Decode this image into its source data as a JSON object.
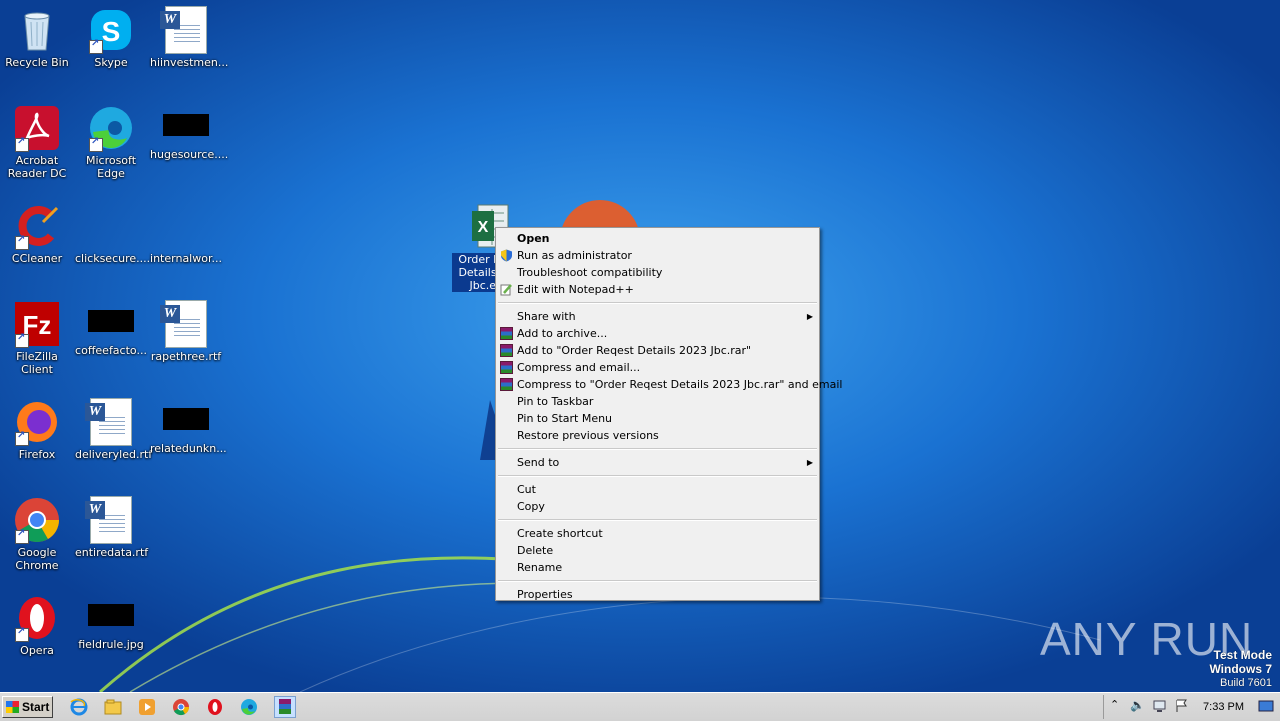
{
  "desktop": {
    "icons": [
      {
        "label": "Recycle Bin"
      },
      {
        "label": "Skype"
      },
      {
        "label": "hiinvestmen..."
      },
      {
        "label": "Acrobat Reader DC"
      },
      {
        "label": "Microsoft Edge"
      },
      {
        "label": "hugesource...."
      },
      {
        "label": "CCleaner"
      },
      {
        "label": "clicksecure...."
      },
      {
        "label": "internalwor..."
      },
      {
        "label": "FileZilla Client"
      },
      {
        "label": "coffeefacto..."
      },
      {
        "label": "rapethree.rtf"
      },
      {
        "label": "Firefox"
      },
      {
        "label": "deliveryled.rtf"
      },
      {
        "label": "relatedunkn..."
      },
      {
        "label": "Google Chrome"
      },
      {
        "label": "entiredata.rtf"
      },
      {
        "label": "Opera"
      },
      {
        "label": "fieldrule.jpg"
      }
    ],
    "selected_file": {
      "label": "Order Re... Details 2... Jbc.e..."
    }
  },
  "context_menu": {
    "items": [
      {
        "label": "Open"
      },
      {
        "label": "Run as administrator"
      },
      {
        "label": "Troubleshoot compatibility"
      },
      {
        "label": "Edit with Notepad++"
      },
      {
        "label": "Share with"
      },
      {
        "label": "Add to archive..."
      },
      {
        "label": "Add to \"Order Reqest Details 2023 Jbc.rar\""
      },
      {
        "label": "Compress and email..."
      },
      {
        "label": "Compress to \"Order Reqest Details 2023 Jbc.rar\" and email"
      },
      {
        "label": "Pin to Taskbar"
      },
      {
        "label": "Pin to Start Menu"
      },
      {
        "label": "Restore previous versions"
      },
      {
        "label": "Send to"
      },
      {
        "label": "Cut"
      },
      {
        "label": "Copy"
      },
      {
        "label": "Create shortcut"
      },
      {
        "label": "Delete"
      },
      {
        "label": "Rename"
      },
      {
        "label": "Properties"
      }
    ]
  },
  "taskbar": {
    "start_label": "Start",
    "clock": "7:33 PM",
    "pinned": [
      "internet-explorer-icon",
      "explorer-icon",
      "media-player-icon",
      "chrome-icon",
      "opera-icon",
      "edge-icon",
      "winrar-icon"
    ]
  },
  "watermark": {
    "line1": "Test Mode",
    "line2": "Windows 7",
    "line3": "Build 7601",
    "brand": "ANY RUN"
  },
  "colors": {
    "selection": "#0b3a8f",
    "menu_bg": "#f0f0f0",
    "desktop": "#1a6fd0"
  }
}
